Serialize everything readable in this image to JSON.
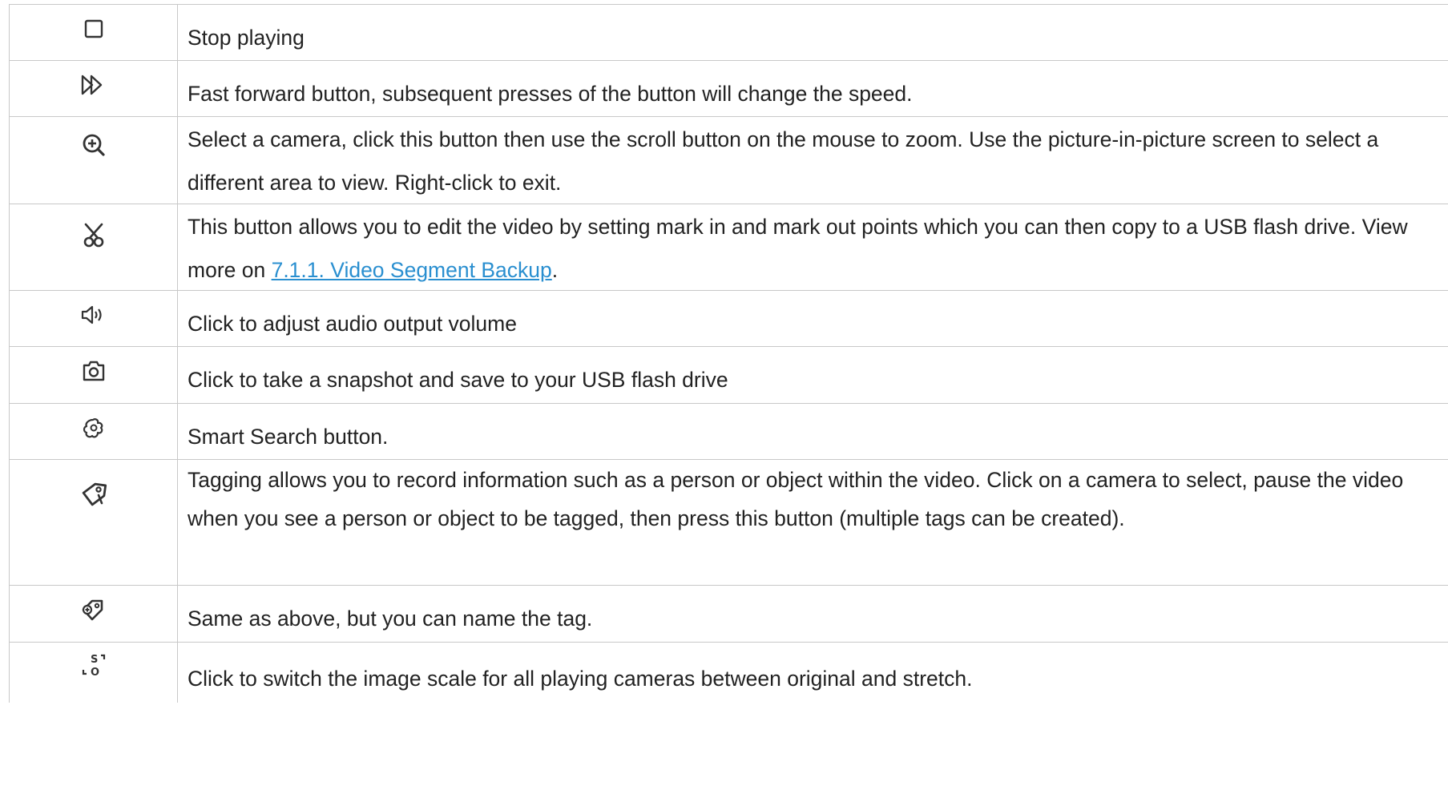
{
  "rows": [
    {
      "icon": "stop-square-icon",
      "text": "Stop playing"
    },
    {
      "icon": "fast-forward-icon",
      "text": "Fast forward button, subsequent presses of the button will change the speed."
    },
    {
      "icon": "zoom-in-icon",
      "text": "Select a camera, click this button then use the scroll button on the mouse to zoom. Use the picture-in-picture screen to select a different area to view. Right-click to exit."
    },
    {
      "icon": "scissors-icon",
      "text_before": "This button allows you to edit the video by setting mark in and mark out points which you can then copy to a USB flash drive. View more on ",
      "link": "7.1.1. Video Segment Backup",
      "text_after": "."
    },
    {
      "icon": "speaker-volume-icon",
      "text": "Click to adjust audio output volume"
    },
    {
      "icon": "camera-snapshot-icon",
      "text": "Click to take a snapshot and save to your USB flash drive"
    },
    {
      "icon": "smart-search-icon",
      "text": "Smart Search button."
    },
    {
      "icon": "tag-icon",
      "text": "Tagging allows you to record information such as a person or object within the video. Click on a camera to select, pause the video when you see a person or object to be tagged, then press this button (multiple tags can be created)."
    },
    {
      "icon": "tag-edit-icon",
      "text": "Same as above, but you can name the tag."
    },
    {
      "icon": "scale-switch-icon",
      "text": "Click to switch the image scale for all playing cameras between original and stretch.",
      "icon_letters": [
        "S",
        "O"
      ]
    }
  ],
  "colors": {
    "border": "#c8c8c8",
    "text": "#222222",
    "link": "#2a8fd0",
    "icon": "#333333"
  }
}
